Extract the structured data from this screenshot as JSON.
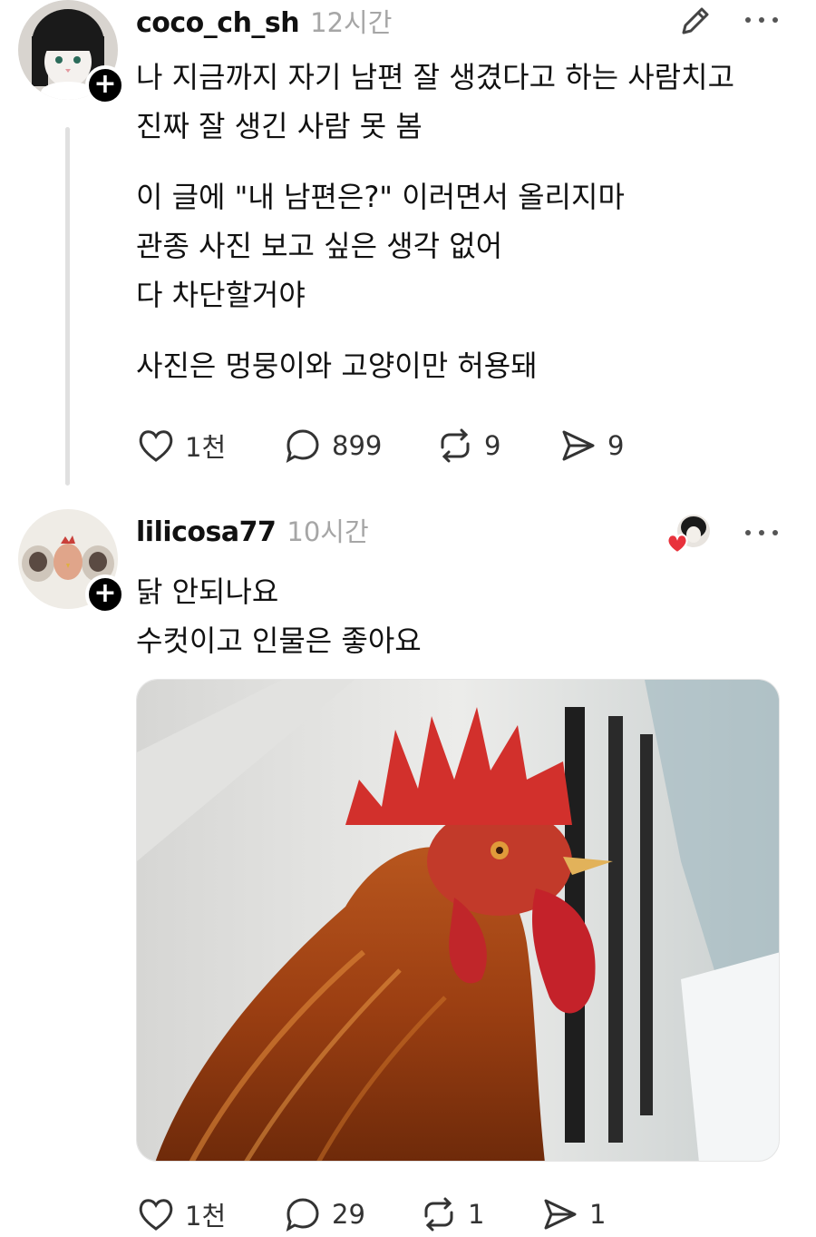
{
  "posts": [
    {
      "username": "coco_ch_sh",
      "time": "12시간",
      "paragraphs": [
        [
          "나 지금까지 자기 남편 잘 생겼다고 하는 사람치고",
          "진짜 잘 생긴 사람 못 봄"
        ],
        [
          "이 글에 \"내 남편은?\" 이러면서 올리지마",
          "관종 사진 보고 싶은 생각 없어",
          "다 차단할거야"
        ],
        [
          "사진은 멍뭉이와 고양이만 허용돼"
        ]
      ],
      "stats": {
        "likes": "1천",
        "replies": "899",
        "reposts": "9",
        "shares": "9"
      },
      "icons": {
        "avatar": "cat-with-bob-wig-avatar",
        "edit": "pencil-icon",
        "more": "more-dots-icon"
      }
    },
    {
      "username": "lilicosa77",
      "time": "10시간",
      "lines": [
        "닭 안되나요",
        "수컷이고 인물은 좋아요"
      ],
      "stats": {
        "likes": "1천",
        "replies": "29",
        "reposts": "1",
        "shares": "1"
      },
      "icons": {
        "avatar": "cats-and-chicken-avatar",
        "liked_by": "liked-by-author-heart-icon",
        "more": "more-dots-icon"
      },
      "image": {
        "subject": "rooster-photo"
      }
    }
  ],
  "colors": {
    "text": "#111111",
    "muted": "#a6a6a6",
    "icon": "#333333",
    "heart": "#e8323c",
    "thread_line": "#e0e0e0"
  }
}
